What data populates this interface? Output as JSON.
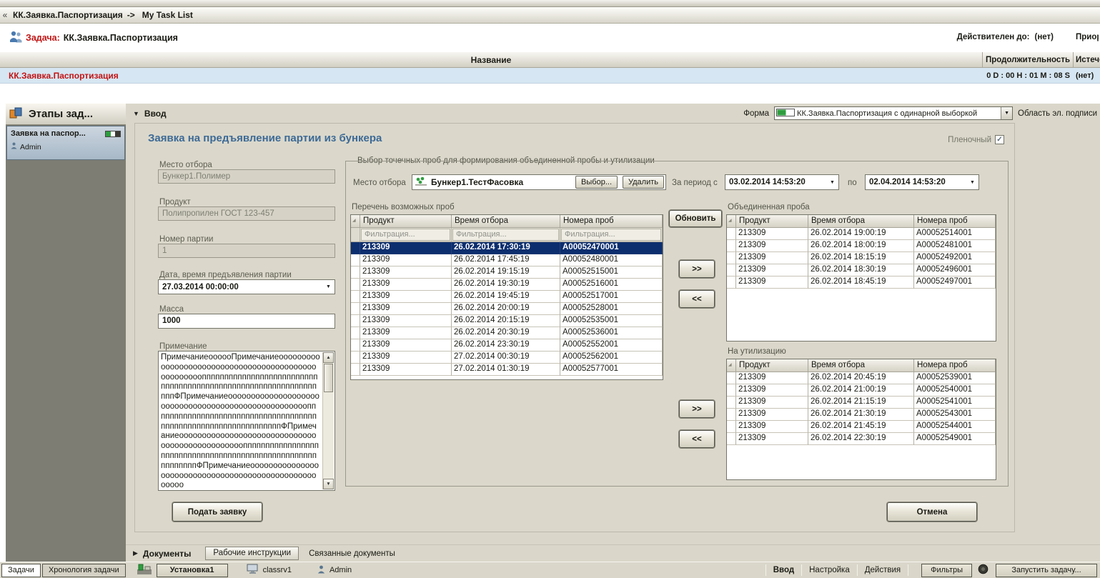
{
  "icons": {
    "collapse": "«",
    "section_open": "▼",
    "section_closed": "▶",
    "dropdown": "▼",
    "scroll_up": "▲",
    "scroll_down": "▼",
    "check": "✓",
    "sort": "◢",
    "crumb_arrow": "->"
  },
  "header": {
    "breadcrumb_root": "КК.Заявка.Паспортизация",
    "breadcrumb_current": "My Task List",
    "task_label": "Задача:",
    "task_name": "КК.Заявка.Паспортизация",
    "valid_label": "Действителен до:",
    "valid_value": "(нет)",
    "priority_label": "Приор"
  },
  "task_grid": {
    "col_name": "Название",
    "col_duration": "Продолжительность",
    "col_expiry": "Истече",
    "row_name": "КК.Заявка.Паспортизация",
    "row_duration": "0 D : 00 H : 01 M : 08 S",
    "row_expiry": "(нет)"
  },
  "sidebar": {
    "title": "Этапы зад...",
    "stage_name": "Заявка на паспор...",
    "stage_user": "Admin"
  },
  "vvod_bar": {
    "title": "Ввод",
    "form_label": "Форма",
    "form_value": "КК.Заявка.Паспортизация с одинарной выборкой",
    "signature_label": "Область эл. подписи"
  },
  "form": {
    "title": "Заявка на предъявление партии из бункера",
    "film_label": "Пленочный",
    "place_label": "Место отбора",
    "place_value": "Бункер1.Полимер",
    "product_label": "Продукт",
    "product_value": "Полипропилен ГОСТ 123-457",
    "batch_label": "Номер партии",
    "batch_value": "1",
    "datetime_label": "Дата, время предъявления партии",
    "datetime_value": "27.03.2014  00:00:00",
    "mass_label": "Масса",
    "mass_value": "1000",
    "note_label": "Примечание",
    "note_value": "ПримечаниеоооооПримечаниеооооооооооооооооооооооооооооооооооооооооооооооооооооппппппппппппппппппппппппппппппппппппппппппппппппппппппппппппппппФПримечаниеооооооооооооооооооооооооооооооооооооооооооооооооооооппппппппппппппппппппппппппппппппппппппппппппппппппппппппппппппппФПримечаниеооооооооооооооооооооооооооооооооооооооооооооооооппппппппппппппппппппппппппппппппппппппппппппппппппппппппппппФПримечаниеоооооооооооооооооооооооооооооооооооооооооооооооооооооо",
    "submit_label": "Подать заявку",
    "cancel_label": "Отмена"
  },
  "selection_group": {
    "legend": "Выбор точечных проб для формирования объединенной пробы и утилизации",
    "place_label": "Место отбора",
    "place_value": "Бункер1.ТестФасовка",
    "choose_label": "Выбор...",
    "delete_label": "Удалить",
    "period_from_label": "За период с",
    "period_from_value": "03.02.2014  14:53:20",
    "period_to_label": "по",
    "period_to_value": "02.04.2014  14:53:20",
    "refresh_label": "Обновить",
    "move_right_label": ">>",
    "move_left_label": "<<",
    "filter_placeholder": "Фильтрация...",
    "possible": {
      "title": "Перечень возможных проб",
      "columns": [
        "Продукт",
        "Время отбора",
        "Номера проб"
      ],
      "selected_index": 0,
      "rows": [
        [
          "213309",
          "26.02.2014 17:30:19",
          "A00052470001"
        ],
        [
          "213309",
          "26.02.2014 17:45:19",
          "A00052480001"
        ],
        [
          "213309",
          "26.02.2014 19:15:19",
          "A00052515001"
        ],
        [
          "213309",
          "26.02.2014 19:30:19",
          "A00052516001"
        ],
        [
          "213309",
          "26.02.2014 19:45:19",
          "A00052517001"
        ],
        [
          "213309",
          "26.02.2014 20:00:19",
          "A00052528001"
        ],
        [
          "213309",
          "26.02.2014 20:15:19",
          "A00052535001"
        ],
        [
          "213309",
          "26.02.2014 20:30:19",
          "A00052536001"
        ],
        [
          "213309",
          "26.02.2014 23:30:19",
          "A00052552001"
        ],
        [
          "213309",
          "27.02.2014 00:30:19",
          "A00052562001"
        ],
        [
          "213309",
          "27.02.2014 01:30:19",
          "A00052577001"
        ]
      ]
    },
    "combined": {
      "title": "Объединенная проба",
      "columns": [
        "Продукт",
        "Время отбора",
        "Номера проб"
      ],
      "rows": [
        [
          "213309",
          "26.02.2014 19:00:19",
          "A00052514001"
        ],
        [
          "213309",
          "26.02.2014 18:00:19",
          "A00052481001"
        ],
        [
          "213309",
          "26.02.2014 18:15:19",
          "A00052492001"
        ],
        [
          "213309",
          "26.02.2014 18:30:19",
          "A00052496001"
        ],
        [
          "213309",
          "26.02.2014 18:45:19",
          "A00052497001"
        ]
      ]
    },
    "utilization": {
      "title": "На утилизацию",
      "columns": [
        "Продукт",
        "Время отбора",
        "Номера проб"
      ],
      "rows": [
        [
          "213309",
          "26.02.2014 20:45:19",
          "A00052539001"
        ],
        [
          "213309",
          "26.02.2014 21:00:19",
          "A00052540001"
        ],
        [
          "213309",
          "26.02.2014 21:15:19",
          "A00052541001"
        ],
        [
          "213309",
          "26.02.2014 21:30:19",
          "A00052543001"
        ],
        [
          "213309",
          "26.02.2014 21:45:19",
          "A00052544001"
        ],
        [
          "213309",
          "26.02.2014 22:30:19",
          "A00052549001"
        ]
      ]
    }
  },
  "docs_bar": {
    "documents_label": "Документы",
    "instructions_label": "Рабочие инструкции",
    "related_label": "Связанные документы"
  },
  "status_bar": {
    "tasks_tab": "Задачи",
    "chronology_tab": "Хронология задачи",
    "installation_label": "Установка1",
    "server_label": "classrv1",
    "user_label": "Admin",
    "vvod_label": "Ввод",
    "settings_label": "Настройка",
    "actions_label": "Действия",
    "filters_label": "Фильтры",
    "run_task_label": "Запустить задачу..."
  }
}
